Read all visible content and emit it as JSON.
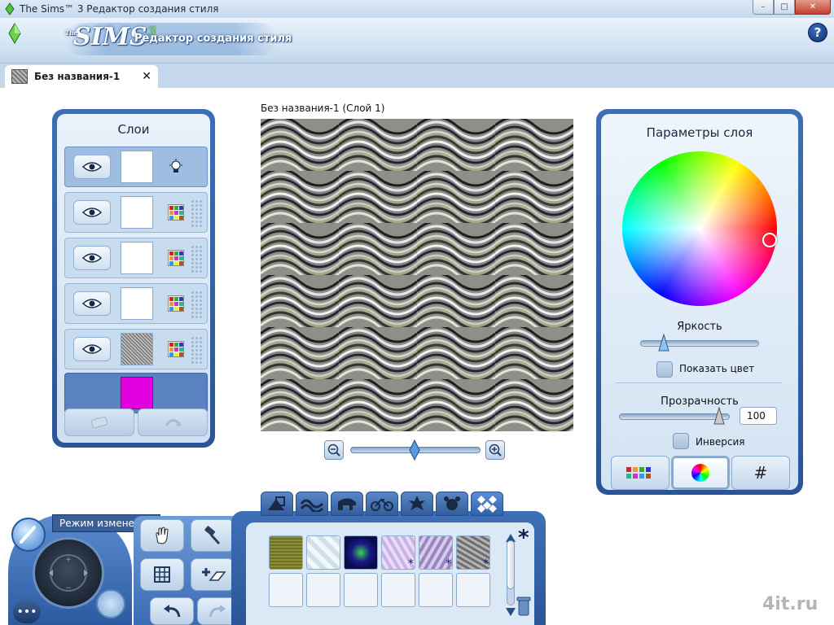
{
  "window": {
    "title": "The Sims™ 3 Редактор создания стиля",
    "minimize": "–",
    "maximize": "□",
    "close": "✕"
  },
  "header": {
    "logo_prefix": "The",
    "logo": "SIMS",
    "logo_num": "3",
    "subtitle": "Редактор создания стиля",
    "help": "?"
  },
  "tab": {
    "label": "Без названия-1",
    "close": "✕"
  },
  "layers_panel": {
    "title": "Слои",
    "rows": [
      {
        "visible": true,
        "thumb": "white",
        "type": "light-icon",
        "selected": true
      },
      {
        "visible": true,
        "thumb": "white",
        "type": "palette-icon"
      },
      {
        "visible": true,
        "thumb": "white",
        "type": "palette-icon"
      },
      {
        "visible": true,
        "thumb": "white",
        "type": "palette-icon"
      },
      {
        "visible": true,
        "thumb": "noise",
        "type": "palette-icon"
      },
      {
        "visible": false,
        "thumb": "magenta",
        "type": "background"
      }
    ]
  },
  "canvas": {
    "title": "Без названия-1 (Слой 1)",
    "zoom_level": 0.5
  },
  "params_panel": {
    "title": "Параметры слоя",
    "brightness_label": "Яркость",
    "brightness": 0.2,
    "show_color_label": "Показать цвет",
    "opacity_label": "Прозрачность",
    "opacity_value": "100",
    "invert_label": "Инверсия",
    "tabs": [
      "palette",
      "wheel",
      "#"
    ],
    "hash": "#",
    "active_tab": 1
  },
  "dock": {
    "tooltip": "Режим изменения",
    "more": "•••"
  },
  "patterns": {
    "categories": [
      "shapes",
      "fabric",
      "animals",
      "vehicles",
      "leaf",
      "toys",
      "diamonds"
    ],
    "active_category": 6,
    "asterisk": "*",
    "swatches": [
      {
        "color": "#7a7a2c",
        "star": false
      },
      {
        "color": "#d8e6ee",
        "star": false
      },
      {
        "color": "#3a3ab0",
        "star": false
      },
      {
        "color": "#b8a0d8",
        "star": true
      },
      {
        "color": "#a894c8",
        "star": true
      },
      {
        "color": "#8a8a8a",
        "star": true
      },
      {
        "color": "",
        "star": false
      },
      {
        "color": "",
        "star": false
      },
      {
        "color": "",
        "star": false
      },
      {
        "color": "",
        "star": false
      },
      {
        "color": "",
        "star": false
      },
      {
        "color": "",
        "star": false
      }
    ]
  },
  "watermark": "4it.ru"
}
